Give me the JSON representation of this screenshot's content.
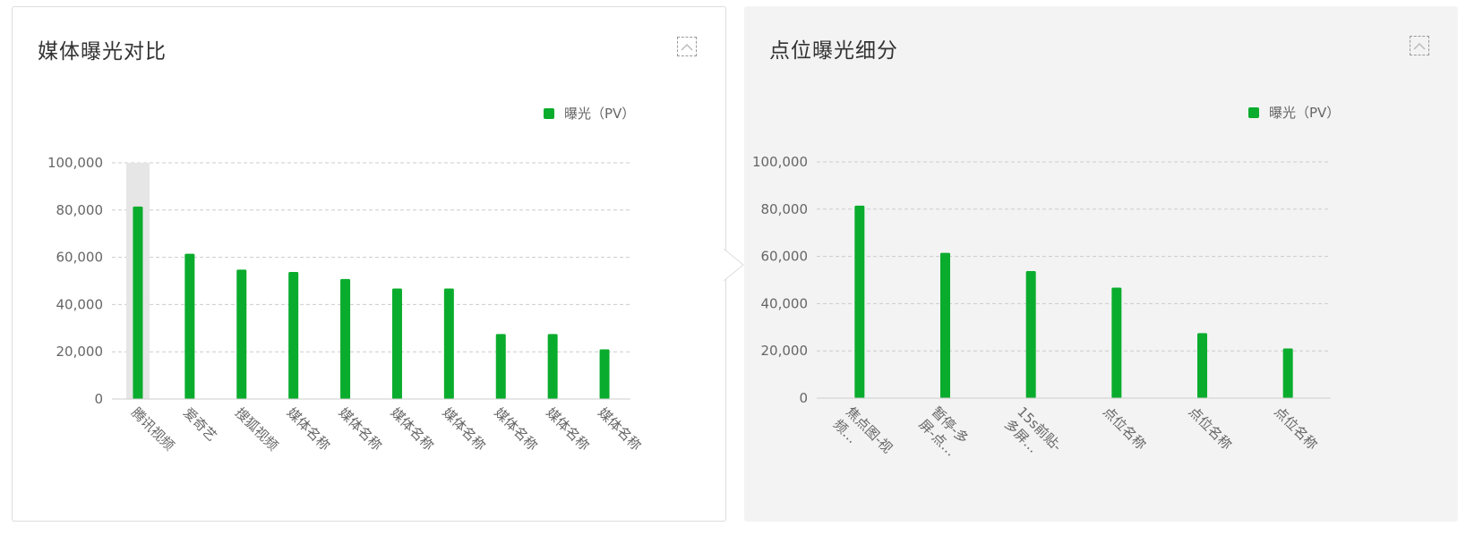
{
  "colors": {
    "bar": "#0aac2d",
    "grid": "#cccccc",
    "axis": "#cccccc",
    "text": "#666666",
    "title": "#333333",
    "highlight": "#e6e6e6"
  },
  "icons": {
    "collapse": "chevron-up-icon"
  },
  "panels": {
    "left": {
      "title": "媒体曝光对比"
    },
    "right": {
      "title": "点位曝光细分"
    }
  },
  "chart_data": [
    {
      "type": "bar",
      "title": "媒体曝光对比",
      "legend": {
        "position": "top-right",
        "label": "曝光（PV）"
      },
      "categories": [
        "腾讯视频",
        "爱奇艺",
        "搜狐视频",
        "媒体名称",
        "媒体名称",
        "媒体名称",
        "媒体名称",
        "媒体名称",
        "媒体名称",
        "媒体名称"
      ],
      "series": [
        {
          "name": "曝光（PV）",
          "values": [
            81500,
            61500,
            54800,
            53800,
            50800,
            46800,
            46800,
            27500,
            27500,
            21000
          ]
        }
      ],
      "highlighted_category": "腾讯视频",
      "ylim": [
        0,
        100000
      ],
      "yticks": [
        "0",
        "20,000",
        "40,000",
        "60,000",
        "80,000",
        "100,000"
      ],
      "grid": true
    },
    {
      "type": "bar",
      "title": "点位曝光细分",
      "legend": {
        "position": "top-right",
        "label": "曝光（PV）"
      },
      "categories": [
        [
          "焦点图-视",
          "频…"
        ],
        [
          "暂停-多",
          "屏-点…"
        ],
        [
          "15s前贴-",
          "多屏…"
        ],
        [
          "点位名称"
        ],
        [
          "点位名称"
        ],
        [
          "点位名称"
        ]
      ],
      "series": [
        {
          "name": "曝光（PV）",
          "values": [
            81500,
            61500,
            53800,
            46800,
            27500,
            21000
          ]
        }
      ],
      "ylim": [
        0,
        100000
      ],
      "yticks": [
        "0",
        "20,000",
        "40,000",
        "60,000",
        "80,000",
        "100,000"
      ],
      "grid": true
    }
  ]
}
